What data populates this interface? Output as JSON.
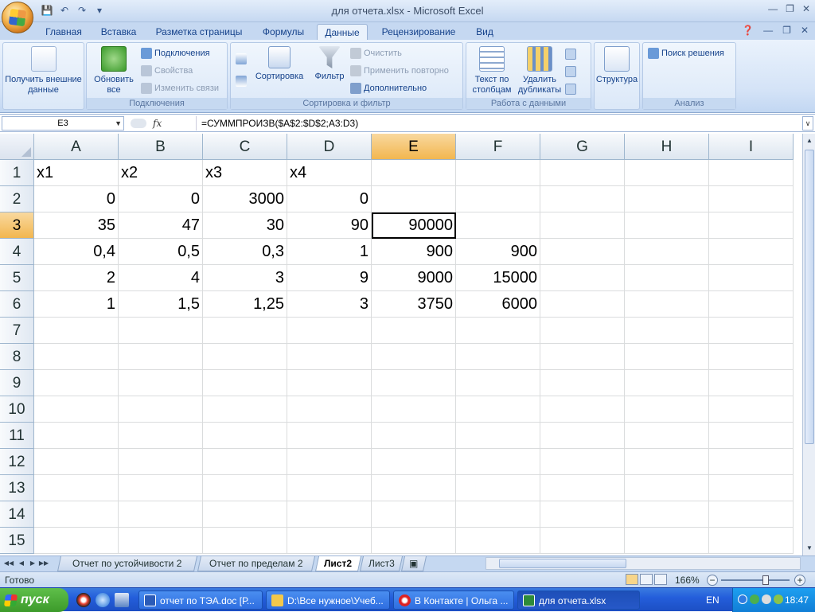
{
  "window": {
    "title": "для отчета.xlsx - Microsoft Excel"
  },
  "ribbon_tabs": [
    "Главная",
    "Вставка",
    "Разметка страницы",
    "Формулы",
    "Данные",
    "Рецензирование",
    "Вид"
  ],
  "active_tab": "Данные",
  "ribbon": {
    "get_external": "Получить внешние данные",
    "refresh_all": "Обновить все",
    "connections": "Подключения",
    "properties": "Свойства",
    "edit_links": "Изменить связи",
    "group_connections": "Подключения",
    "sort": "Сортировка",
    "filter": "Фильтр",
    "clear": "Очистить",
    "reapply": "Применить повторно",
    "advanced": "Дополнительно",
    "group_sort": "Сортировка и фильтр",
    "text_to_columns": "Текст по столбцам",
    "remove_dupes": "Удалить дубликаты",
    "group_data_tools": "Работа с данными",
    "outline": "Структура",
    "solver": "Поиск решения",
    "group_analysis": "Анализ"
  },
  "formula_bar": {
    "name_box": "E3",
    "fx": "fx",
    "formula": "=СУММПРОИЗВ($A$2:$D$2;A3:D3)"
  },
  "grid": {
    "columns": [
      "A",
      "B",
      "C",
      "D",
      "E",
      "F",
      "G",
      "H",
      "I"
    ],
    "rows": [
      "1",
      "2",
      "3",
      "4",
      "5",
      "6",
      "7",
      "8",
      "9",
      "10",
      "11",
      "12",
      "13",
      "14",
      "15"
    ],
    "active_col": "E",
    "active_row": "3",
    "cells": [
      {
        "ref": "A1",
        "value": "x1",
        "type": "text"
      },
      {
        "ref": "B1",
        "value": "x2",
        "type": "text"
      },
      {
        "ref": "C1",
        "value": "x3",
        "type": "text"
      },
      {
        "ref": "D1",
        "value": "x4",
        "type": "text"
      },
      {
        "ref": "A2",
        "value": "0",
        "type": "num"
      },
      {
        "ref": "B2",
        "value": "0",
        "type": "num"
      },
      {
        "ref": "C2",
        "value": "3000",
        "type": "num"
      },
      {
        "ref": "D2",
        "value": "0",
        "type": "num"
      },
      {
        "ref": "A3",
        "value": "35",
        "type": "num"
      },
      {
        "ref": "B3",
        "value": "47",
        "type": "num"
      },
      {
        "ref": "C3",
        "value": "30",
        "type": "num"
      },
      {
        "ref": "D3",
        "value": "90",
        "type": "num"
      },
      {
        "ref": "E3",
        "value": "90000",
        "type": "num"
      },
      {
        "ref": "A4",
        "value": "0,4",
        "type": "num"
      },
      {
        "ref": "B4",
        "value": "0,5",
        "type": "num"
      },
      {
        "ref": "C4",
        "value": "0,3",
        "type": "num"
      },
      {
        "ref": "D4",
        "value": "1",
        "type": "num"
      },
      {
        "ref": "E4",
        "value": "900",
        "type": "num"
      },
      {
        "ref": "F4",
        "value": "900",
        "type": "num"
      },
      {
        "ref": "A5",
        "value": "2",
        "type": "num"
      },
      {
        "ref": "B5",
        "value": "4",
        "type": "num"
      },
      {
        "ref": "C5",
        "value": "3",
        "type": "num"
      },
      {
        "ref": "D5",
        "value": "9",
        "type": "num"
      },
      {
        "ref": "E5",
        "value": "9000",
        "type": "num"
      },
      {
        "ref": "F5",
        "value": "15000",
        "type": "num"
      },
      {
        "ref": "A6",
        "value": "1",
        "type": "num"
      },
      {
        "ref": "B6",
        "value": "1,5",
        "type": "num"
      },
      {
        "ref": "C6",
        "value": "1,25",
        "type": "num"
      },
      {
        "ref": "D6",
        "value": "3",
        "type": "num"
      },
      {
        "ref": "E6",
        "value": "3750",
        "type": "num"
      },
      {
        "ref": "F6",
        "value": "6000",
        "type": "num"
      }
    ]
  },
  "sheet_tabs": [
    "Отчет по устойчивости 2",
    "Отчет по пределам 2",
    "Лист2",
    "Лист3"
  ],
  "active_sheet": "Лист2",
  "status": {
    "text": "Готово",
    "zoom": "166%"
  },
  "taskbar": {
    "start": "пуск",
    "tasks": [
      "отчет по ТЭА.doc [Р...",
      "D:\\Все нужное\\Учеб...",
      "В Контакте | Ольга ...",
      "для отчета.xlsx"
    ],
    "active_task": "для отчета.xlsx",
    "lang": "EN",
    "clock": "18:47"
  },
  "colors": {
    "ribbon_bg": "#d4e3f7",
    "active_header": "#f2b64f",
    "taskbar": "#245edb",
    "start": "#3c9a2a"
  }
}
